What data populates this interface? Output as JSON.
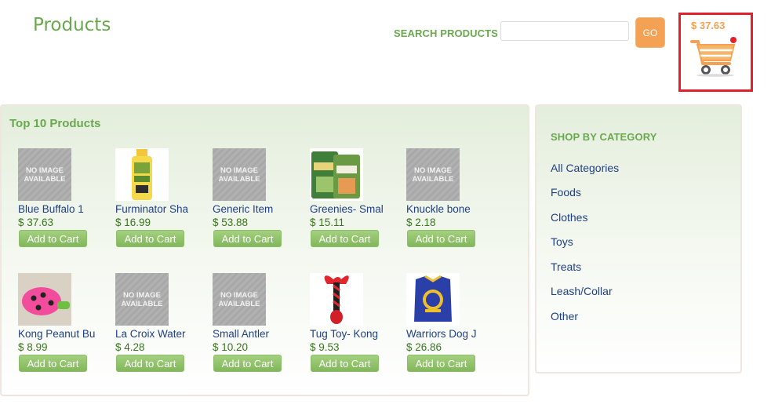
{
  "header": {
    "title": "Products",
    "search_label": "SEARCH PRODUCTS",
    "search_value": "",
    "search_placeholder": "",
    "go_label": "GO"
  },
  "cart": {
    "total": "$ 37.63",
    "icon": "shopping-cart-icon",
    "highlight_color": "#e32029",
    "icon_color": "#f5a153"
  },
  "top_products": {
    "title": "Top 10 Products",
    "add_label": "Add to Cart",
    "items": [
      {
        "name": "Blue Buffalo 1",
        "price": "$ 37.63",
        "image": "NO IMAGE AVAILABLE"
      },
      {
        "name": "Furminator Sha",
        "price": "$ 16.99",
        "image": "photo"
      },
      {
        "name": "Generic Item",
        "price": "$ 53.88",
        "image": "NO IMAGE AVAILABLE"
      },
      {
        "name": "Greenies- Smal",
        "price": "$ 15.11",
        "image": "photo"
      },
      {
        "name": "Knuckle bone",
        "price": "$ 2.18",
        "image": "NO IMAGE AVAILABLE"
      },
      {
        "name": "Kong Peanut Bu",
        "price": "$ 8.99",
        "image": "photo"
      },
      {
        "name": "La Croix Water",
        "price": "$ 4.28",
        "image": "NO IMAGE AVAILABLE"
      },
      {
        "name": "Small Antler",
        "price": "$ 10.20",
        "image": "NO IMAGE AVAILABLE"
      },
      {
        "name": "Tug Toy- Kong",
        "price": "$ 9.53",
        "image": "photo"
      },
      {
        "name": "Warriors Dog J",
        "price": "$ 26.86",
        "image": "photo"
      }
    ],
    "no_image_text": [
      "NO IMAGE",
      "AVAILABLE"
    ]
  },
  "categories": {
    "heading": "SHOP BY CATEGORY",
    "items": [
      "All Categories",
      "Foods",
      "Clothes",
      "Toys",
      "Treats",
      "Leash/Collar",
      "Other"
    ]
  },
  "colors": {
    "brand_green": "#6aa84f",
    "link_blue": "#1f3f83",
    "price_green": "#38761d",
    "accent_orange": "#f5a153"
  }
}
